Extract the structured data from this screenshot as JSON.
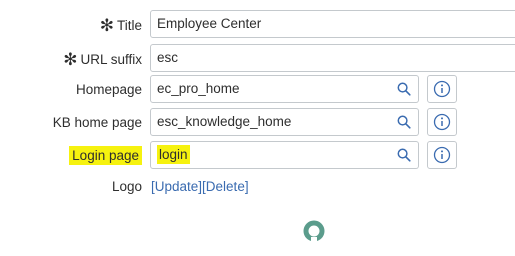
{
  "form": {
    "title": {
      "label": "Title",
      "required": true,
      "value": "Employee Center"
    },
    "url_suffix": {
      "label": "URL suffix",
      "required": true,
      "value": "esc"
    },
    "homepage": {
      "label": "Homepage",
      "value": "ec_pro_home"
    },
    "kb_home_page": {
      "label": "KB home page",
      "value": "esc_knowledge_home"
    },
    "login_page": {
      "label": "Login page",
      "value": "login"
    },
    "logo": {
      "label": "Logo",
      "update_link": "[Update]",
      "delete_link": "[Delete]"
    }
  },
  "icons": {
    "required": "asterisk-icon",
    "lookup": "search-icon",
    "info": "info-icon",
    "loading": "loading-spinner-icon"
  },
  "colors": {
    "highlight": "#f6f20f",
    "link": "#3a6bb0",
    "icon_blue": "#3a6bb0",
    "spinner": "#5b9c8c"
  }
}
